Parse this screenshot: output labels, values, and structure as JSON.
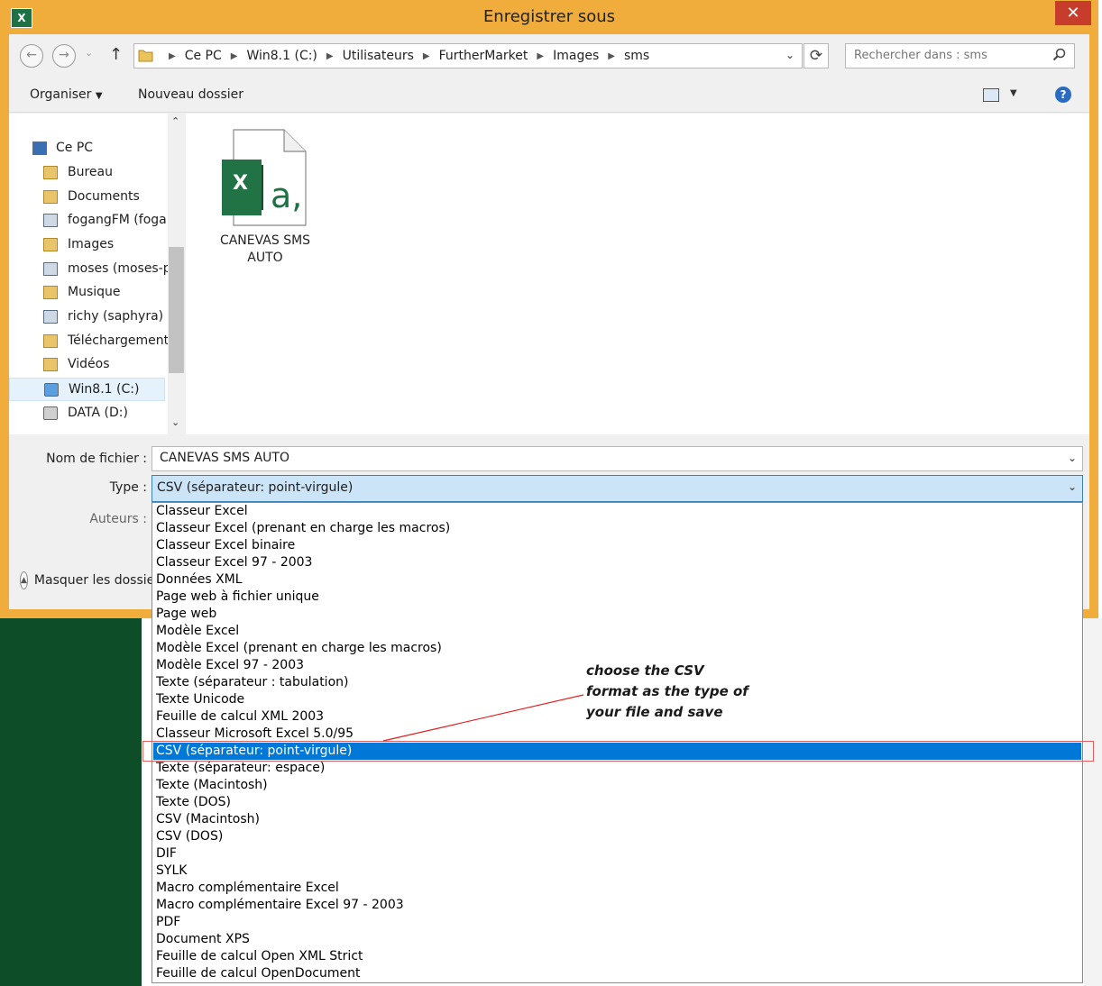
{
  "window": {
    "title": "Enregistrer sous",
    "app_icon": "X",
    "close_glyph": "✕"
  },
  "navigation": {
    "back_glyph": "←",
    "forward_glyph": "→",
    "recent_glyph": "⌄",
    "up_glyph": "↑",
    "breadcrumb": [
      "Ce PC",
      "Win8.1 (C:)",
      "Utilisateurs",
      "FurtherMarket",
      "Images",
      "sms"
    ],
    "search_placeholder": "Rechercher dans : sms"
  },
  "toolbar": {
    "organize_label": "Organiser",
    "new_folder_label": "Nouveau dossier"
  },
  "nav_pane": {
    "items": [
      {
        "label": "Ce PC",
        "icon": "computer-icon"
      },
      {
        "label": "Bureau",
        "icon": "folder-icon"
      },
      {
        "label": "Documents",
        "icon": "folder-icon"
      },
      {
        "label": "fogangFM (foga",
        "icon": "network-user-icon"
      },
      {
        "label": "Images",
        "icon": "folder-icon"
      },
      {
        "label": "moses (moses-p",
        "icon": "network-user-icon"
      },
      {
        "label": "Musique",
        "icon": "folder-icon"
      },
      {
        "label": "richy (saphyra)",
        "icon": "network-user-icon"
      },
      {
        "label": "Téléchargement",
        "icon": "folder-icon"
      },
      {
        "label": "Vidéos",
        "icon": "folder-icon"
      },
      {
        "label": "Win8.1 (C:)",
        "icon": "drive-icon"
      },
      {
        "label": "DATA (D:)",
        "icon": "drive-icon"
      }
    ]
  },
  "files": [
    {
      "name": "CANEVAS SMS AUTO",
      "icon_letters": [
        "X",
        "a,"
      ]
    }
  ],
  "form": {
    "filename_label": "Nom de fichier :",
    "filename_value": "CANEVAS SMS AUTO",
    "type_label": "Type :",
    "type_value": "CSV (séparateur: point-virgule)",
    "authors_label": "Auteurs :",
    "hide_folders_label": "Masquer les dossiers"
  },
  "type_options": [
    "Classeur Excel",
    "Classeur Excel (prenant en charge les macros)",
    "Classeur Excel binaire",
    "Classeur Excel 97 - 2003",
    "Données XML",
    "Page web à fichier unique",
    "Page web",
    "Modèle Excel",
    "Modèle Excel (prenant en charge les macros)",
    "Modèle Excel 97 - 2003",
    "Texte (séparateur : tabulation)",
    "Texte Unicode",
    "Feuille de calcul XML 2003",
    "Classeur Microsoft Excel 5.0/95",
    "CSV (séparateur: point-virgule)",
    "Texte (séparateur: espace)",
    "Texte (Macintosh)",
    "Texte (DOS)",
    "CSV (Macintosh)",
    "CSV (DOS)",
    "DIF",
    "SYLK",
    "Macro complémentaire Excel",
    "Macro complémentaire Excel 97 - 2003",
    "PDF",
    "Document XPS",
    "Feuille de calcul Open XML Strict",
    "Feuille de calcul OpenDocument"
  ],
  "selected_type_index": 14,
  "annotation": {
    "lines": [
      "choose the  CSV",
      "format as the type of",
      "your file and save"
    ]
  },
  "colors": {
    "title_bar": "#f1ad3b",
    "selection": "#0078d7",
    "excel_green": "#0d4d28",
    "annotation_red": "#e02020"
  }
}
